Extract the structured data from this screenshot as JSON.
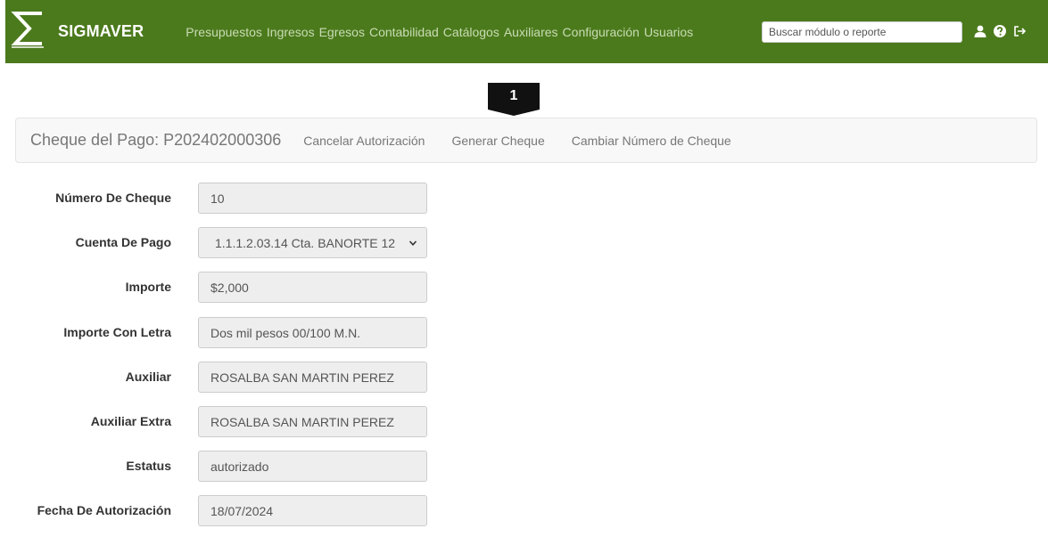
{
  "brand": {
    "name": "SIGMAVER"
  },
  "nav": {
    "items": [
      "Presupuestos",
      "Ingresos",
      "Egresos",
      "Contabilidad",
      "Catálogos",
      "Auxiliares",
      "Configuración",
      "Usuarios"
    ],
    "search_placeholder": "Buscar módulo o reporte",
    "icons": [
      "user-icon",
      "help-icon",
      "logout-icon"
    ]
  },
  "marker": {
    "label": "1"
  },
  "subheader": {
    "title": "Cheque del Pago: P202402000306",
    "links": [
      "Cancelar Autorización",
      "Generar Cheque",
      "Cambiar Número de Cheque"
    ]
  },
  "form": {
    "fields": [
      {
        "label": "Número De Cheque",
        "value": "10"
      },
      {
        "label": "Cuenta De Pago",
        "value": "1.1.1.2.03.14 Cta. BANORTE 12"
      },
      {
        "label": "Importe",
        "value": "$2,000"
      },
      {
        "label": "Importe Con Letra",
        "value": "Dos mil pesos 00/100 M.N."
      },
      {
        "label": "Auxiliar",
        "value": "ROSALBA SAN MARTIN PEREZ"
      },
      {
        "label": "Auxiliar Extra",
        "value": "ROSALBA SAN MARTIN PEREZ"
      },
      {
        "label": "Estatus",
        "value": "autorizado"
      },
      {
        "label": "Fecha De Autorización",
        "value": "18/07/2024"
      }
    ]
  },
  "colors": {
    "navbar": "#4b7a1c",
    "nav_text": "#c9dcb4",
    "field_bg": "#eeeeee"
  }
}
